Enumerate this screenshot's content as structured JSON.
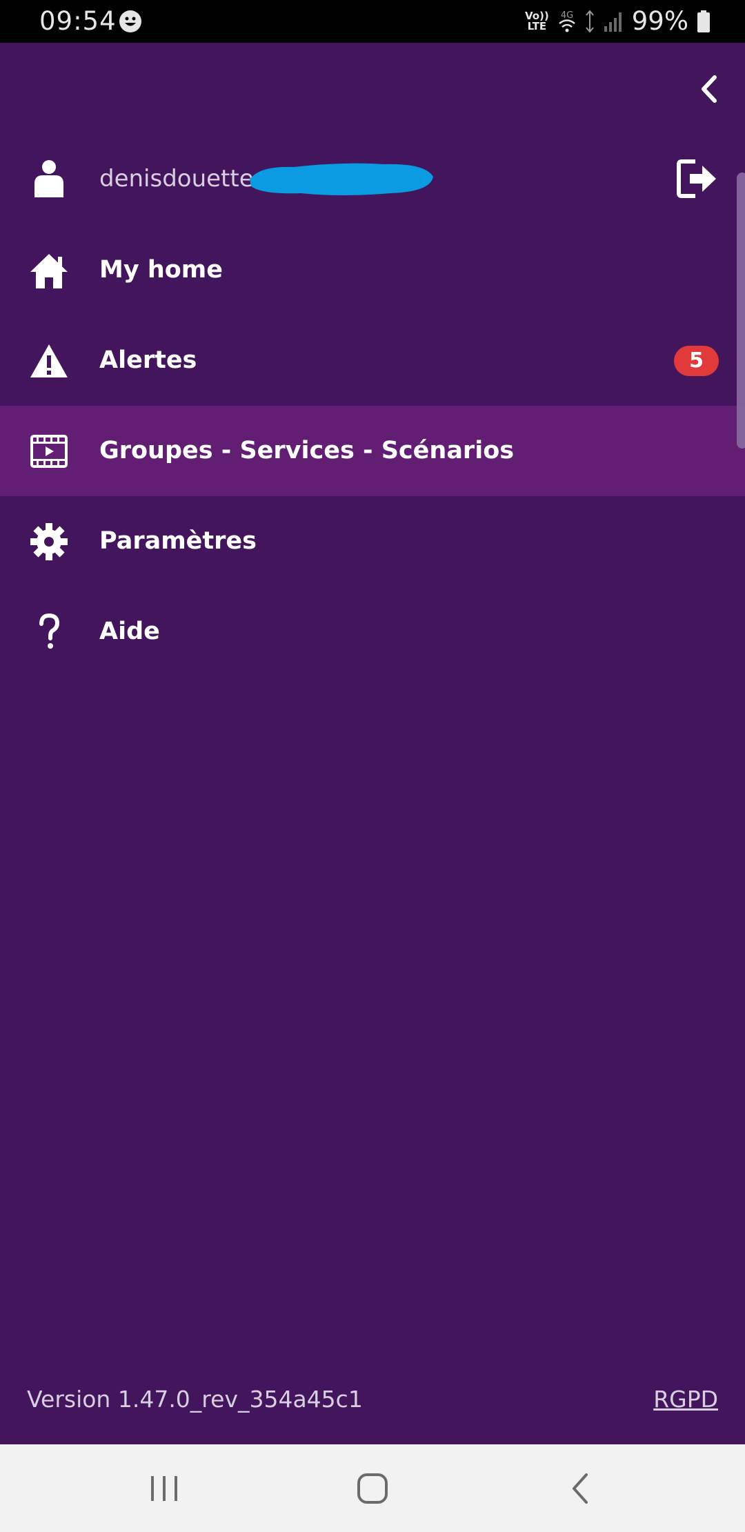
{
  "status_bar": {
    "time": "09:54",
    "volte_top": "Vo))",
    "volte_bottom": "LTE",
    "network": "4G",
    "battery": "99%"
  },
  "drawer": {
    "user": {
      "name": "denisdouette"
    },
    "menu": [
      {
        "label": "My home",
        "icon": "home-icon"
      },
      {
        "label": "Alertes",
        "icon": "warning-icon",
        "badge": "5"
      },
      {
        "label": "Groupes - Services - Scénarios",
        "icon": "film-icon",
        "active": true
      },
      {
        "label": "Paramètres",
        "icon": "gear-icon"
      },
      {
        "label": "Aide",
        "icon": "help-icon"
      }
    ],
    "footer": {
      "version": "Version 1.47.0_rev_354a45c1",
      "rgpd": "RGPD"
    }
  },
  "colors": {
    "background": "#42155c",
    "active_item": "#611e72",
    "badge": "#e03a3a",
    "redaction": "#0a9be3",
    "nav_bar": "#f2f2f2"
  }
}
